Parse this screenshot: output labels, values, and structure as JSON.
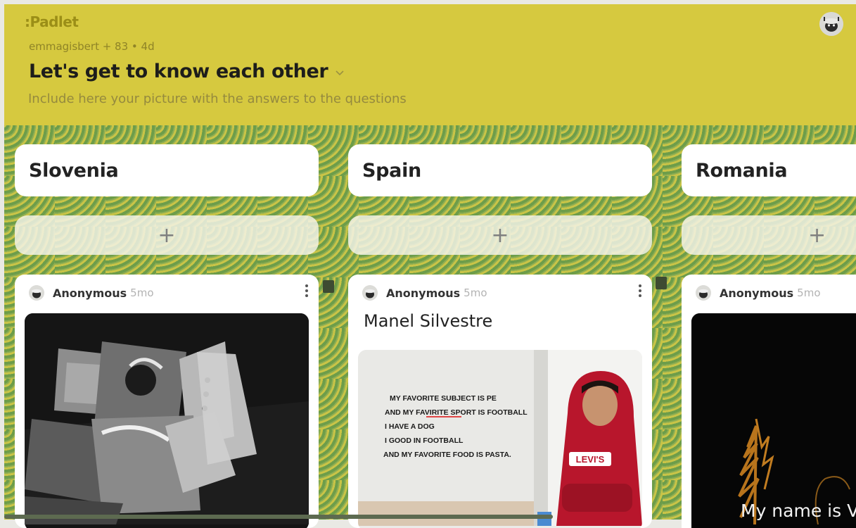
{
  "header": {
    "logo": ":Padlet",
    "meta": "emmagisbert + 83 • 4d",
    "title": "Let's get to know each other",
    "subtitle": "Include here your picture with the answers to the questions"
  },
  "columns": [
    {
      "heading": "Slovenia",
      "add_label": "+",
      "post": {
        "author": "Anonymous",
        "age": "5mo"
      }
    },
    {
      "heading": "Spain",
      "add_label": "+",
      "post": {
        "author": "Anonymous",
        "age": "5mo",
        "title": "Manel Silvestre",
        "image_text": [
          "MY FAVORITE SUBJECT IS PE",
          "AND MY FAVIRITE SPORT IS FOOTBALL",
          "I HAVE A DOG",
          "I GOOD IN FOOTBALL",
          "AND MY FAVORITE FOOD IS PASTA."
        ],
        "shirt_logo": "LEVI'S"
      }
    },
    {
      "heading": "Romania",
      "add_label": "+",
      "post": {
        "author": "Anonymous",
        "age": "5mo",
        "image_caption": "My name is V"
      }
    }
  ],
  "colors": {
    "header_bg": "#d6c93f",
    "wallpaper_green": "#6d9d4a",
    "wallpaper_yellow": "#c9c447"
  },
  "icons": [
    "user-avatar-icon",
    "plus-icon",
    "more-vertical-icon",
    "chevron-down-icon"
  ]
}
